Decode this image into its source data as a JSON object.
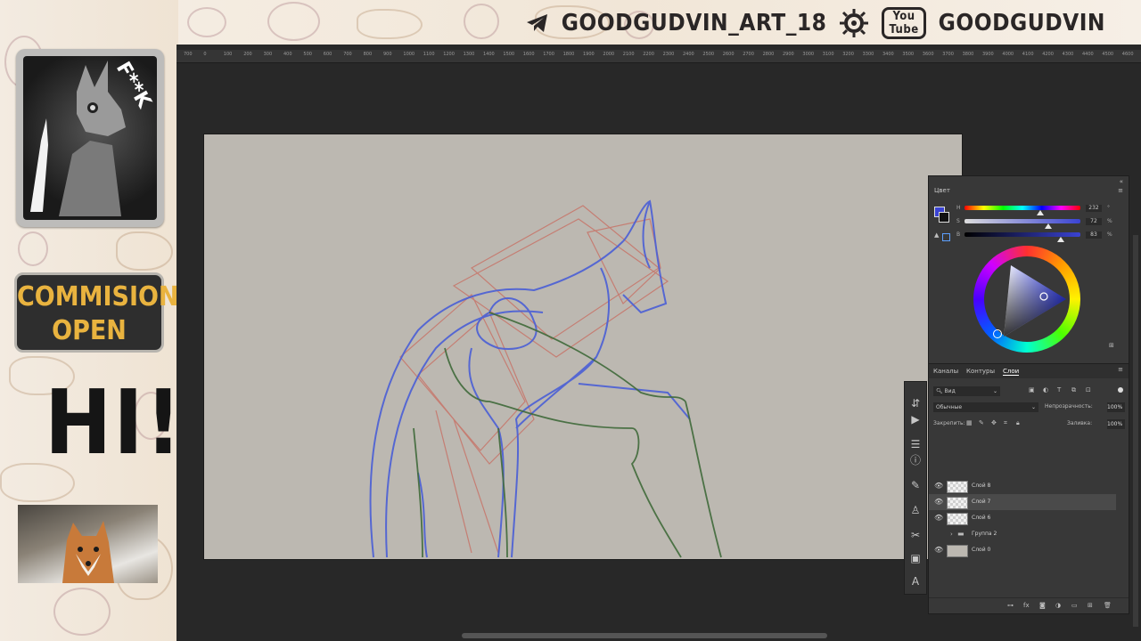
{
  "overlay": {
    "telegram_handle": "GOODGUDVIN_ART_18",
    "youtube_top": "You",
    "youtube_bottom": "Tube",
    "youtube_handle": "GOODGUDVIN",
    "avatar_text": "F**K",
    "commission_line1": "COMMISION",
    "commission_line2": "OPEN",
    "greeting": "HI!"
  },
  "ruler": {
    "ticks": [
      "700",
      "0",
      "100",
      "200",
      "300",
      "400",
      "500",
      "600",
      "700",
      "800",
      "900",
      "1000",
      "1100",
      "1200",
      "1300",
      "1400",
      "1500",
      "1600",
      "1700",
      "1800",
      "1900",
      "2000",
      "2100",
      "2200",
      "2300",
      "2400",
      "2500",
      "2600",
      "2700",
      "2800",
      "2900",
      "3000",
      "3100",
      "3200",
      "3300",
      "3400",
      "3500",
      "3600",
      "3700",
      "3800",
      "3900",
      "4000",
      "4100",
      "4200",
      "4300",
      "4400",
      "4500",
      "4600"
    ]
  },
  "color_panel": {
    "title": "Цвет",
    "h_label": "H",
    "s_label": "S",
    "b_label": "B",
    "h_value": "232",
    "s_value": "72",
    "b_value": "83",
    "h_unit": "°",
    "s_unit": "%",
    "b_unit": "%",
    "h_level": 0.65,
    "s_level": 0.72,
    "b_level": 0.83,
    "fg_color": "#3a43d3",
    "bg_color": "#111111"
  },
  "layers_panel": {
    "tabs": [
      "Каналы",
      "Контуры",
      "Слои"
    ],
    "active_tab": "Слои",
    "filter_label": "Вид",
    "blend_mode": "Обычные",
    "opacity_label": "Непрозрачность:",
    "opacity_value": "100%",
    "lock_label": "Закрепить:",
    "fill_label": "Заливка:",
    "fill_value": "100%",
    "layers": [
      {
        "name": "Слой 8",
        "visible": true,
        "selected": false,
        "type": "layer"
      },
      {
        "name": "Слой 7",
        "visible": true,
        "selected": true,
        "type": "layer"
      },
      {
        "name": "Слой 6",
        "visible": true,
        "selected": false,
        "type": "layer"
      },
      {
        "name": "Группа 2",
        "visible": false,
        "selected": false,
        "type": "group"
      },
      {
        "name": "Слой 0",
        "visible": true,
        "selected": false,
        "type": "background"
      }
    ]
  },
  "colors": {
    "sketch_blue": "#4a5fd6",
    "sketch_red": "#c77469",
    "sketch_green": "#3f6a3a",
    "canvas_bg": "#bcb8b1",
    "commission_gold": "#e9b33f"
  }
}
